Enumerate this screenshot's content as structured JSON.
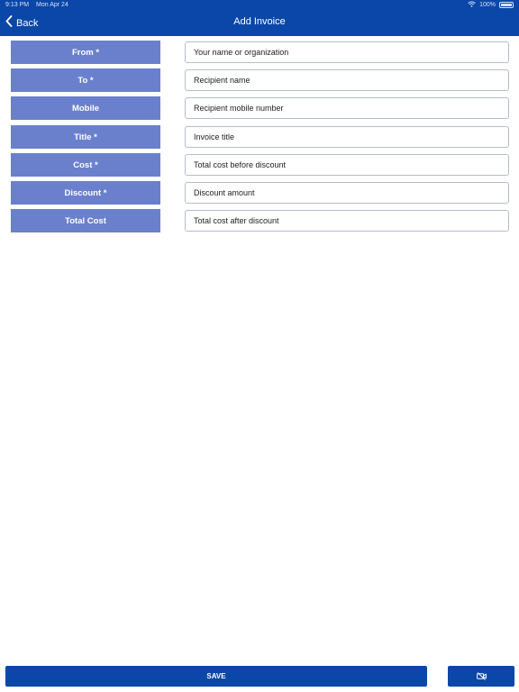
{
  "status_bar": {
    "time": "9:13 PM",
    "date": "Mon Apr 24",
    "battery": "100%"
  },
  "header": {
    "back_label": "Back",
    "title": "Add Invoice"
  },
  "form": {
    "fields": [
      {
        "label": "From *",
        "placeholder": "Your name or organization"
      },
      {
        "label": "To *",
        "placeholder": "Recipient name"
      },
      {
        "label": "Mobile",
        "placeholder": "Recipient mobile number"
      },
      {
        "label": "Title *",
        "placeholder": "Invoice title"
      },
      {
        "label": "Cost *",
        "placeholder": "Total cost before discount"
      },
      {
        "label": "Discount *",
        "placeholder": "Discount amount"
      },
      {
        "label": "Total Cost",
        "placeholder": "Total cost after discount"
      }
    ]
  },
  "footer": {
    "save_label": "SAVE",
    "aux_icon": "no-camera-icon"
  },
  "colors": {
    "primary": "#0a47a8",
    "label_bg": "#6a80cc",
    "input_border": "#b5bccc"
  }
}
